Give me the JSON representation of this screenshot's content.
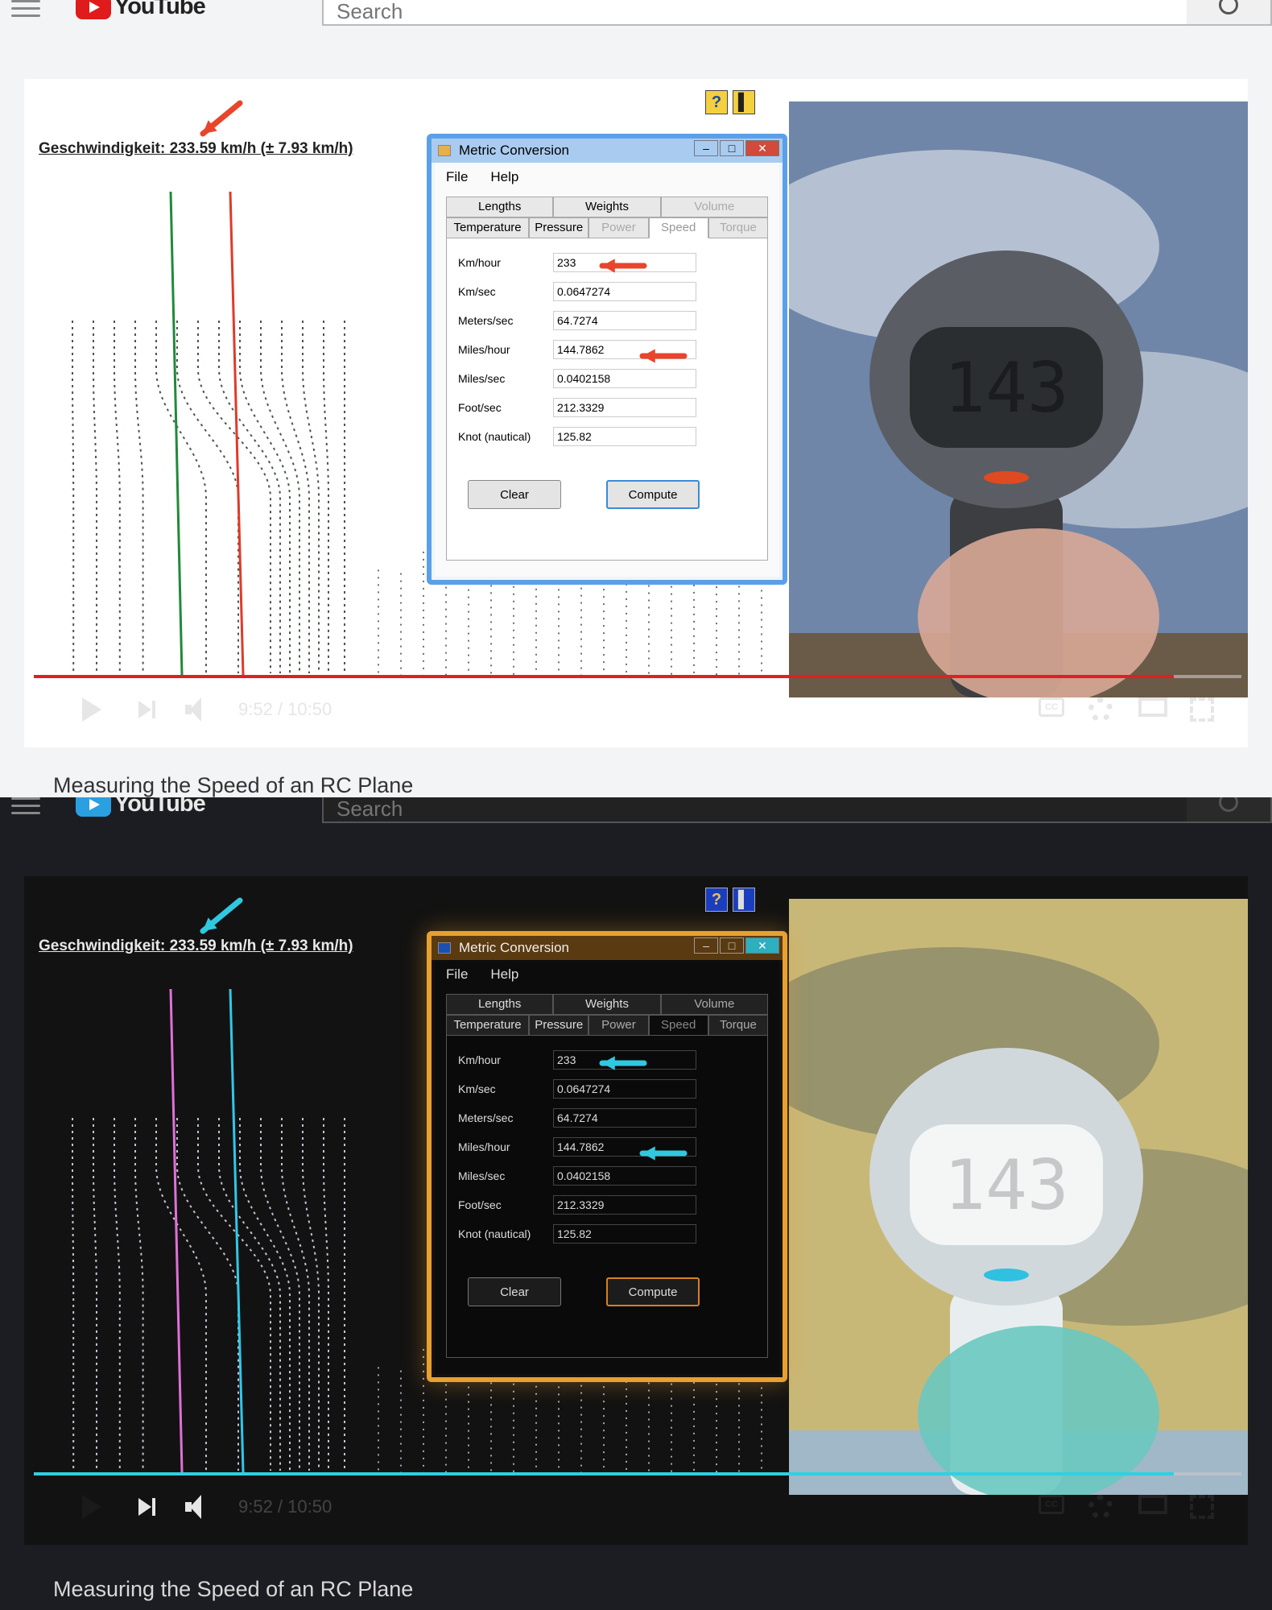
{
  "header": {
    "logo_text": "YouTube",
    "search_placeholder": "Search"
  },
  "video": {
    "title": "Measuring the Speed of an RC Plane",
    "time": "9:52 / 10:50",
    "progress": 0.944
  },
  "overlay": {
    "speed_text": "Geschwindigkeit: 233.59 km/h (± 7.93 km/h)",
    "help_button": "?",
    "exit_button": "▌"
  },
  "dialog": {
    "title": "Metric Conversion",
    "menu": [
      "File",
      "Help"
    ],
    "tabs_row1": [
      "Lengths",
      "Weights",
      "Volume"
    ],
    "tabs_row2": [
      "Temperature",
      "Pressure",
      "Power",
      "Speed",
      "Torque"
    ],
    "active_tab": "Speed",
    "fields": [
      {
        "label": "Km/hour",
        "value": "233"
      },
      {
        "label": "Km/sec",
        "value": "0.0647274"
      },
      {
        "label": "Meters/sec",
        "value": "64.7274"
      },
      {
        "label": "Miles/hour",
        "value": "144.7862"
      },
      {
        "label": "Miles/sec",
        "value": "0.0402158"
      },
      {
        "label": "Foot/sec",
        "value": "212.3329"
      },
      {
        "label": "Knot (nautical)",
        "value": "125.82"
      }
    ],
    "buttons": {
      "clear": "Clear",
      "compute": "Compute"
    }
  },
  "radar_gun": {
    "display": "143"
  },
  "panels": {
    "top": {
      "arrow_color": "#e8452c",
      "line_a": "#1f8a3a",
      "line_b": "#e03a2a",
      "progress_color": "#e02020",
      "dialog_border": "#5aa0e8"
    },
    "bottom": {
      "arrow_color": "#30c8e0",
      "line_a": "#e070d8",
      "line_b": "#30c8e8",
      "progress_color": "#30d0e0",
      "dialog_border": "#e8a030"
    }
  }
}
